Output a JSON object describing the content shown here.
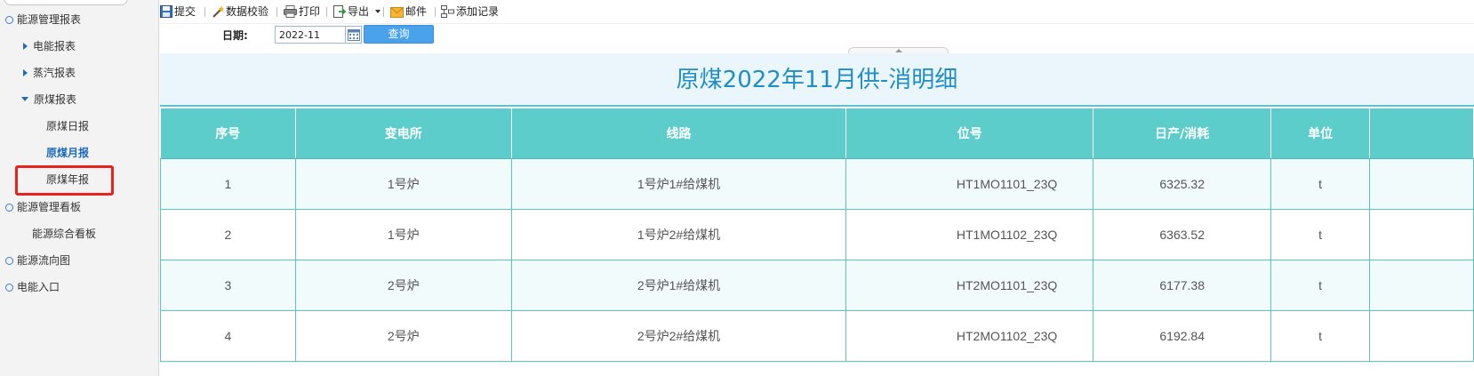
{
  "sidebar": {
    "items": [
      {
        "label": "能源管理报表"
      },
      {
        "label": "电能报表"
      },
      {
        "label": "蒸汽报表"
      },
      {
        "label": "原煤报表"
      },
      {
        "label": "原煤日报"
      },
      {
        "label": "原煤月报"
      },
      {
        "label": "原煤年报"
      },
      {
        "label": "能源管理看板"
      },
      {
        "label": "能源综合看板"
      },
      {
        "label": "能源流向图"
      },
      {
        "label": "电能入口"
      }
    ]
  },
  "toolbar": {
    "submit_label": "提交",
    "validate_label": "数据校验",
    "print_label": "打印",
    "export_label": "导出",
    "mail_label": "邮件",
    "add_record_label": "添加记录"
  },
  "query": {
    "date_label": "日期:",
    "date_value": "2022-11",
    "query_button": "查询"
  },
  "report": {
    "title": "原煤2022年11月供-消明细",
    "columns": [
      "序号",
      "变电所",
      "线路",
      "位号",
      "日产/消耗",
      "单位"
    ],
    "rows": [
      [
        "1",
        "1号炉",
        "1号炉1#给煤机",
        "HT1MO1101_23Q",
        "6325.32",
        "t"
      ],
      [
        "2",
        "1号炉",
        "1号炉2#给煤机",
        "HT1MO1102_23Q",
        "6363.52",
        "t"
      ],
      [
        "3",
        "2号炉",
        "2号炉1#给煤机",
        "HT2MO1101_23Q",
        "6177.38",
        "t"
      ],
      [
        "4",
        "2号炉",
        "2号炉2#给煤机",
        "HT2MO1102_23Q",
        "6192.84",
        "t"
      ]
    ]
  }
}
